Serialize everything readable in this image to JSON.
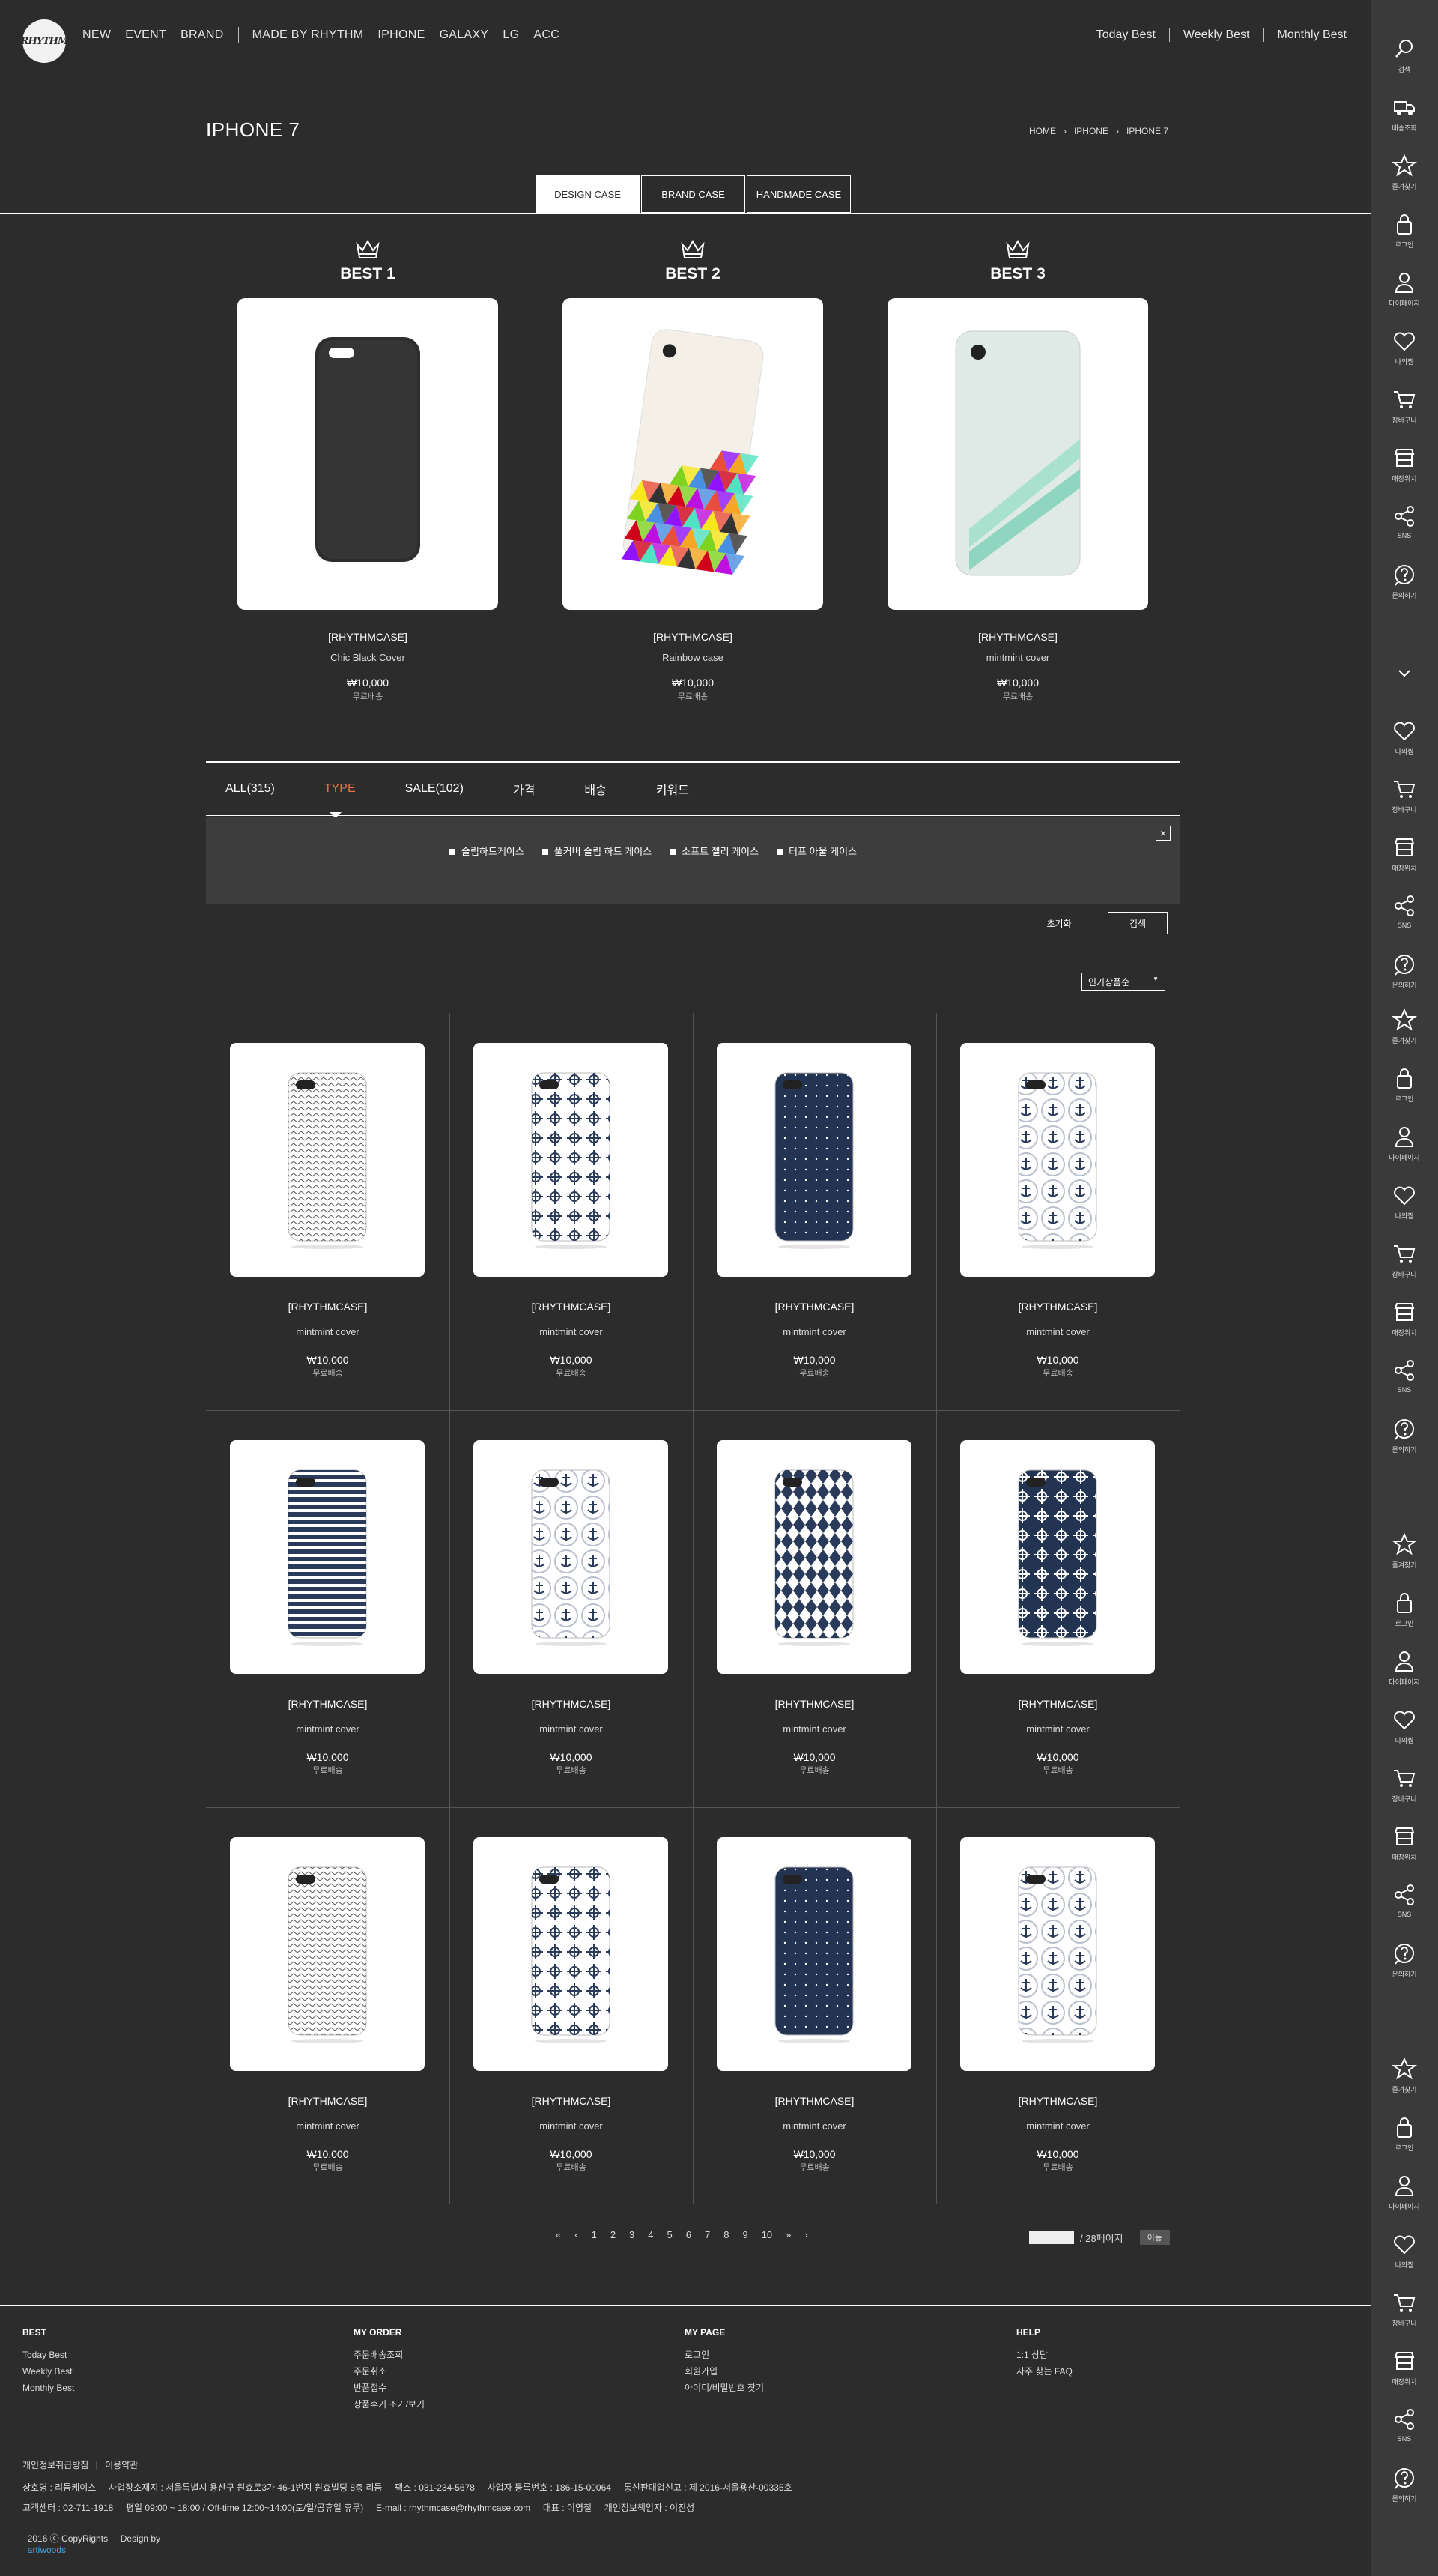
{
  "logo": "RHYTHM",
  "nav": {
    "main": [
      "NEW",
      "EVENT",
      "BRAND"
    ],
    "sub": [
      "MADE BY RHYTHM",
      "IPHONE",
      "GALAXY",
      "LG",
      "ACC"
    ],
    "best_links": [
      "Today Best",
      "Weekly Best",
      "Monthly Best"
    ]
  },
  "page": {
    "title": "IPHONE 7",
    "breadcrumb": [
      "HOME",
      "IPHONE",
      "IPHONE 7"
    ]
  },
  "tabs": [
    "DESIGN CASE",
    "BRAND CASE",
    "HANDMADE CASE"
  ],
  "best": [
    {
      "label": "BEST 1",
      "brand": "[RHYTHMCASE]",
      "name": "Chic Black Cover",
      "price": "₩10,000",
      "ship": "무료배송"
    },
    {
      "label": "BEST 2",
      "brand": "[RHYTHMCASE]",
      "name": "Rainbow case",
      "price": "₩10,000",
      "ship": "무료배송"
    },
    {
      "label": "BEST 3",
      "brand": "[RHYTHMCASE]",
      "name": "mintmint cover",
      "price": "₩10,000",
      "ship": "무료배송"
    }
  ],
  "filter": {
    "tabs": [
      "ALL(315)",
      "TYPE",
      "SALE(102)",
      "가격",
      "배송",
      "키워드"
    ],
    "options": [
      "슬림하드케이스",
      "풀커버 슬림 하드 케이스",
      "소프트 젤리 케이스",
      "터프 아울 케이스"
    ],
    "close": "×",
    "reset": "초기화",
    "search": "검색",
    "sort": "인기상품순",
    "sort_arrow": "▼"
  },
  "products": [
    {
      "brand": "[RHYTHMCASE]",
      "name": "mintmint cover",
      "price": "₩10,000",
      "ship": "무료배송"
    },
    {
      "brand": "[RHYTHMCASE]",
      "name": "mintmint cover",
      "price": "₩10,000",
      "ship": "무료배송"
    },
    {
      "brand": "[RHYTHMCASE]",
      "name": "mintmint cover",
      "price": "₩10,000",
      "ship": "무료배송"
    },
    {
      "brand": "[RHYTHMCASE]",
      "name": "mintmint cover",
      "price": "₩10,000",
      "ship": "무료배송"
    },
    {
      "brand": "[RHYTHMCASE]",
      "name": "mintmint cover",
      "price": "₩10,000",
      "ship": "무료배송"
    },
    {
      "brand": "[RHYTHMCASE]",
      "name": "mintmint cover",
      "price": "₩10,000",
      "ship": "무료배송"
    },
    {
      "brand": "[RHYTHMCASE]",
      "name": "mintmint cover",
      "price": "₩10,000",
      "ship": "무료배송"
    },
    {
      "brand": "[RHYTHMCASE]",
      "name": "mintmint cover",
      "price": "₩10,000",
      "ship": "무료배송"
    },
    {
      "brand": "[RHYTHMCASE]",
      "name": "mintmint cover",
      "price": "₩10,000",
      "ship": "무료배송"
    },
    {
      "brand": "[RHYTHMCASE]",
      "name": "mintmint cover",
      "price": "₩10,000",
      "ship": "무료배송"
    },
    {
      "brand": "[RHYTHMCASE]",
      "name": "mintmint cover",
      "price": "₩10,000",
      "ship": "무료배송"
    },
    {
      "brand": "[RHYTHMCASE]",
      "name": "mintmint cover",
      "price": "₩10,000",
      "ship": "무료배송"
    }
  ],
  "pagination": {
    "first": "«",
    "prev": "‹",
    "pages": [
      "1",
      "2",
      "3",
      "4",
      "5",
      "6",
      "7",
      "8",
      "9",
      "10"
    ],
    "next_group": "»",
    "next": "›",
    "total": "/ 28페이지",
    "go": "이동"
  },
  "footer": {
    "cols": [
      {
        "title": "BEST",
        "items": [
          "Today Best",
          "Weekly Best",
          "Monthly Best"
        ]
      },
      {
        "title": "MY ORDER",
        "items": [
          "주문배송조회",
          "주문취소",
          "반품접수",
          "상품후기 조기/보기"
        ]
      },
      {
        "title": "MY PAGE",
        "items": [
          "로그인",
          "회원가입",
          "아이디/비밀번호 찾기"
        ]
      },
      {
        "title": "HELP",
        "items": [
          "1:1 상담",
          "자주 찾는 FAQ"
        ]
      }
    ],
    "policy": [
      "개인정보취급방침",
      "이용약관"
    ],
    "line1": "상호명 : 리듬케이스     사업장소재지 : 서울특별시 용산구 원효로3가 46-1번지 원효빌딩 8층 리듬     팩스 : 031-234-5678     사업자 등록번호 : 186-15-00064     통신판매업신고 : 제 2016-서울용산-00335호",
    "line2": "고객센터 : 02-711-1918     평일 09:00 ~ 18:00 / Off-time 12:00~14:00(토/일/공휴일 휴무)     E-mail : rhythmcase@rhythmcase.com     대표 : 이영철     개인정보책임자 : 이진성",
    "copyright": "2016 ⓒ CopyRights     Design by",
    "designer": "artiwoods"
  },
  "sidebar": {
    "group1": [
      "검색",
      "배송조회",
      "즐겨찾기",
      "로그인",
      "마이페이지",
      "나의찜",
      "장바구니",
      "매장위치",
      "SNS",
      "문의하기"
    ],
    "group2": [
      "나의찜",
      "장바구니",
      "매장위치",
      "SNS",
      "문의하기"
    ],
    "group3": [
      "즐겨찾기",
      "로그인",
      "마이페이지",
      "나의찜",
      "장바구니",
      "매장위치",
      "SNS",
      "문의하기"
    ],
    "group4": [
      "즐겨찾기",
      "로그인",
      "마이페이지",
      "나의찜",
      "장바구니",
      "매장위치",
      "SNS",
      "문의하기"
    ],
    "group5": [
      "즐겨찾기",
      "로그인",
      "마이페이지",
      "나의찜",
      "장바구니",
      "매장위치",
      "SNS",
      "문의하기"
    ]
  }
}
